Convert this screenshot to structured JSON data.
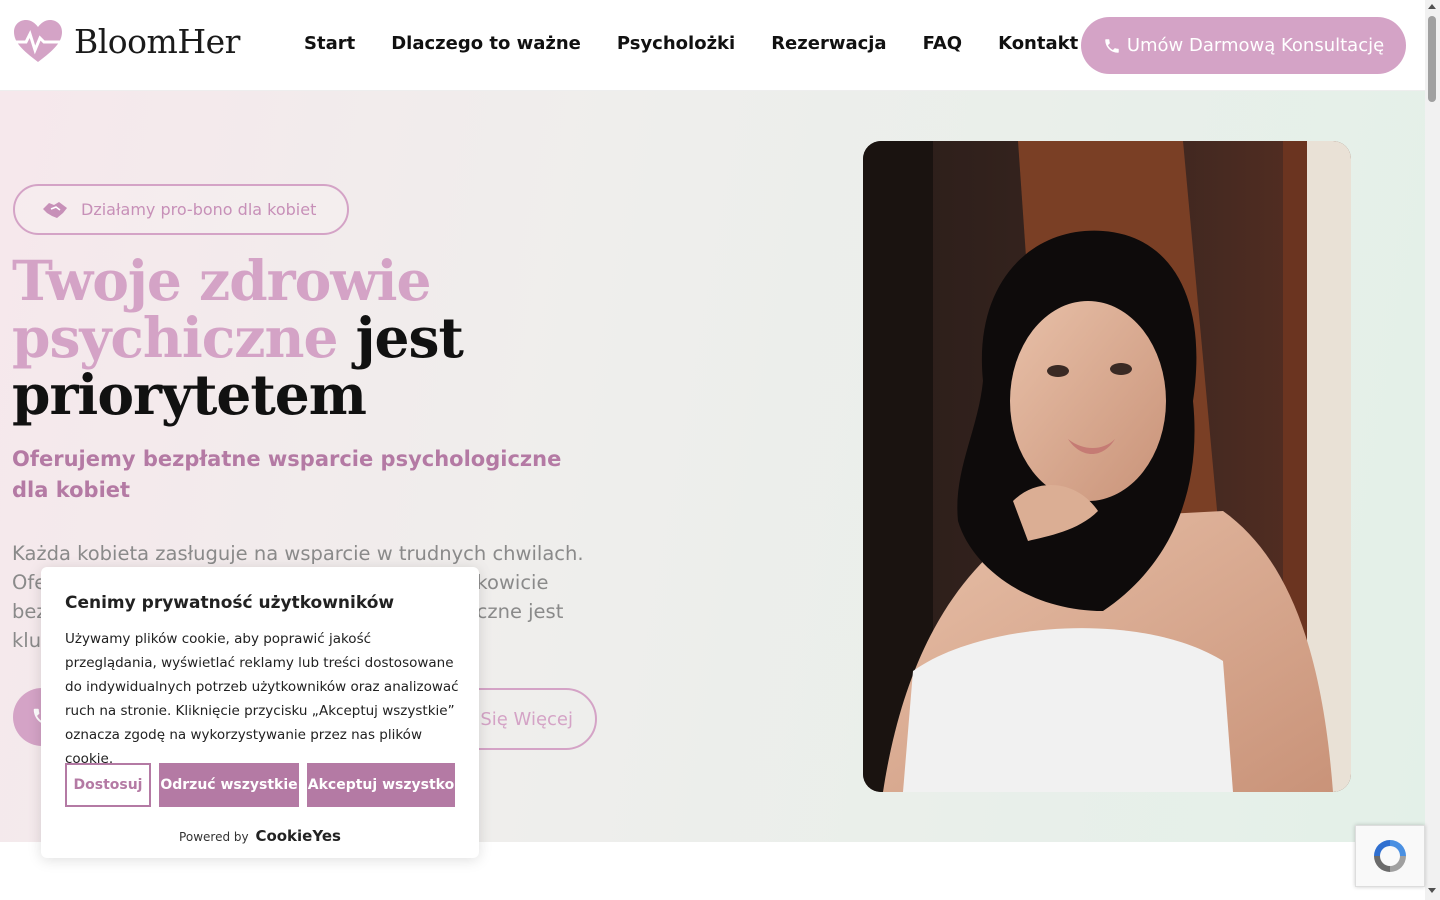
{
  "brand": {
    "name": "BloomHer",
    "accent": "#d4a3c6",
    "accent_dark": "#b47aa4"
  },
  "nav": {
    "items": [
      {
        "label": "Start"
      },
      {
        "label": "Dlaczego to ważne"
      },
      {
        "label": "Psycholożki"
      },
      {
        "label": "Rezerwacja"
      },
      {
        "label": "FAQ"
      },
      {
        "label": "Kontakt"
      }
    ],
    "cta_label": "Umów Darmową Konsultację",
    "cta_icon": "phone-icon"
  },
  "hero": {
    "badge_label": "Działamy pro-bono dla kobiet",
    "badge_icon": "handshake-icon",
    "headline_part1": "Twoje zdrowie",
    "headline_part2": "psychiczne",
    "headline_part3": "jest",
    "headline_part4": "priorytetem",
    "subheadline": "Oferujemy bezpłatne wsparcie psychologiczne dla kobiet",
    "body_visible": "Każda kobieta zasługuje na wsparcie w trudnych chwilach. Ofe                                  całkowicie bez                                                    czne jest klu",
    "learn_more_label": "Się Więcej",
    "photo_alt": "portrait-photo"
  },
  "cookie": {
    "title": "Cenimy prywatność użytkowników",
    "text": "Używamy plików cookie, aby poprawić jakość przeglądania, wyświetlać reklamy lub treści dostosowane do indywidualnych potrzeb użytkowników oraz analizować ruch na stronie. Kliknięcie przycisku „Akceptuj wszystkie” oznacza zgodę na wykorzystywanie przez nas plików cookie.",
    "customize_label": "Dostosuj",
    "reject_label": "Odrzuć wszystkie",
    "accept_label": "Akceptuj wszystko",
    "powered_by": "Powered by",
    "powered_brand": "CookieYes"
  }
}
